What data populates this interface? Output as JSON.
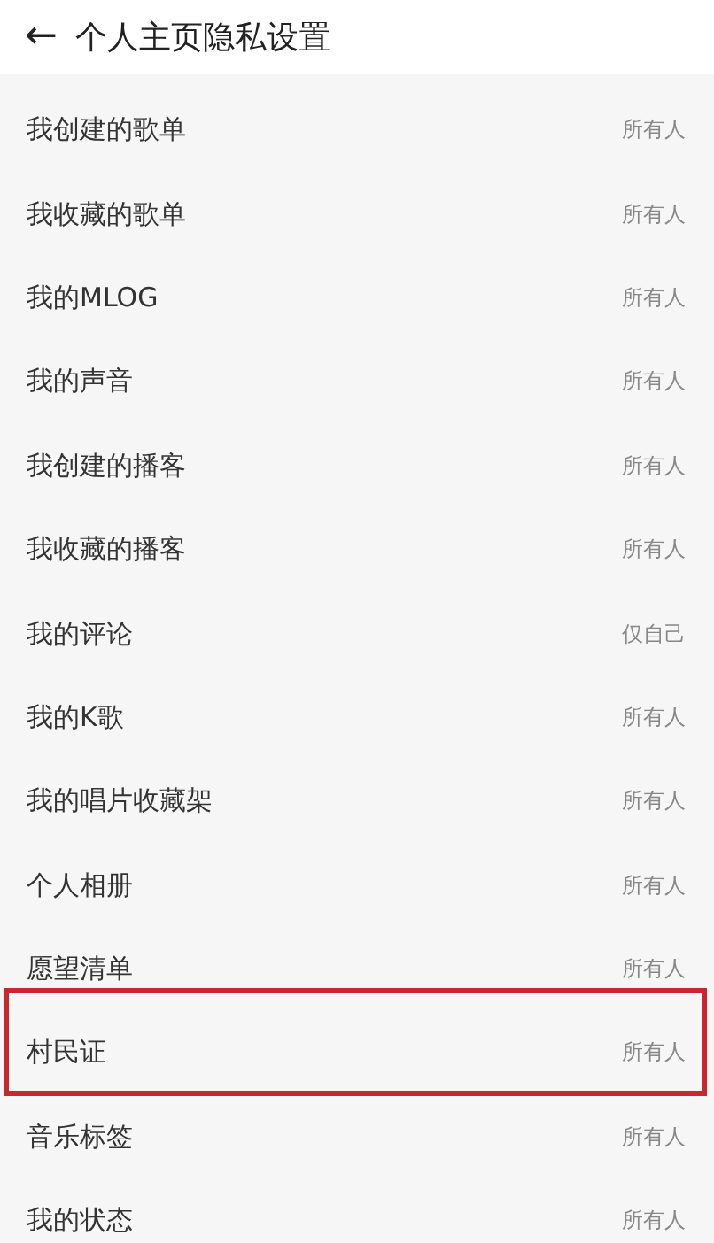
{
  "header": {
    "back": "←",
    "title": "个人主页隐私设置"
  },
  "rows": [
    {
      "label": "我创建的歌单",
      "value": "所有人",
      "highlighted": false
    },
    {
      "label": "我收藏的歌单",
      "value": "所有人",
      "highlighted": false
    },
    {
      "label": "我的MLOG",
      "value": "所有人",
      "highlighted": false
    },
    {
      "label": "我的声音",
      "value": "所有人",
      "highlighted": false
    },
    {
      "label": "我创建的播客",
      "value": "所有人",
      "highlighted": false
    },
    {
      "label": "我收藏的播客",
      "value": "所有人",
      "highlighted": false
    },
    {
      "label": "我的评论",
      "value": "仅自己",
      "highlighted": false
    },
    {
      "label": "我的K歌",
      "value": "所有人",
      "highlighted": false
    },
    {
      "label": "我的唱片收藏架",
      "value": "所有人",
      "highlighted": false
    },
    {
      "label": "个人相册",
      "value": "所有人",
      "highlighted": false
    },
    {
      "label": "愿望清单",
      "value": "所有人",
      "highlighted": false
    },
    {
      "label": "村民证",
      "value": "所有人",
      "highlighted": true
    },
    {
      "label": "音乐标签",
      "value": "所有人",
      "highlighted": false
    },
    {
      "label": "我的状态",
      "value": "所有人",
      "highlighted": false
    }
  ]
}
